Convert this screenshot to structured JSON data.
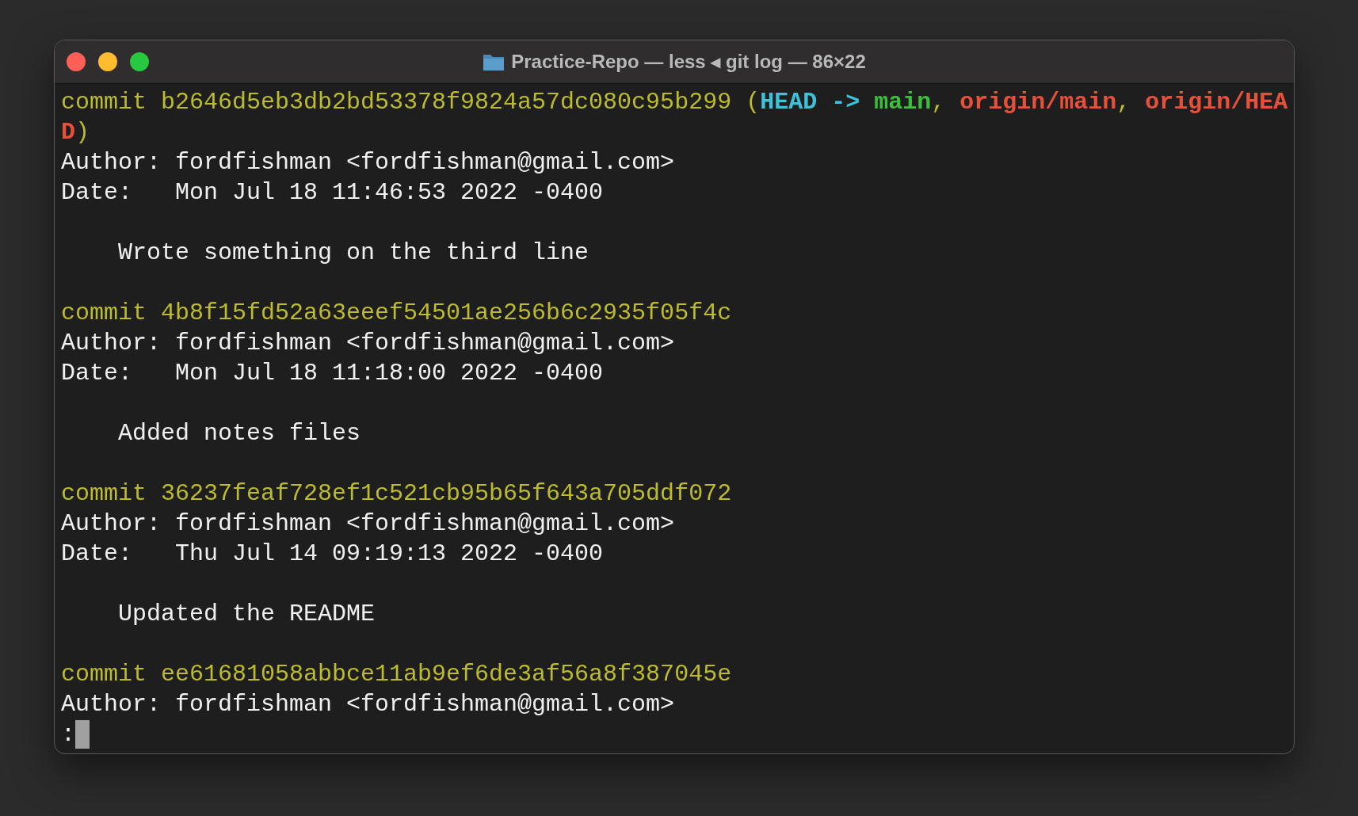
{
  "window": {
    "title": "Practice-Repo — less ◂ git log — 86×22"
  },
  "lines": [
    {
      "kind": "text",
      "segments": [
        {
          "kind": "hash",
          "text": "commit b2646d5eb3db2bd53378f9824a57dc080c95b299 ("
        },
        {
          "kind": "head",
          "text": "HEAD -> "
        },
        {
          "kind": "branch",
          "text": "main"
        },
        {
          "kind": "hash",
          "text": ", "
        },
        {
          "kind": "remote",
          "text": "origin/main"
        },
        {
          "kind": "hash",
          "text": ", "
        },
        {
          "kind": "remote",
          "text": "origin/HEA"
        }
      ]
    },
    {
      "kind": "text",
      "segments": [
        {
          "kind": "remote",
          "text": "D"
        },
        {
          "kind": "hash",
          "text": ")"
        }
      ]
    },
    {
      "kind": "text",
      "segments": [
        {
          "kind": "plain",
          "text": "Author: fordfishman <fordfishman@gmail.com>"
        }
      ]
    },
    {
      "kind": "text",
      "segments": [
        {
          "kind": "plain",
          "text": "Date:   Mon Jul 18 11:46:53 2022 -0400"
        }
      ]
    },
    {
      "kind": "blank"
    },
    {
      "kind": "text",
      "segments": [
        {
          "kind": "plain",
          "text": "    Wrote something on the third line"
        }
      ]
    },
    {
      "kind": "blank"
    },
    {
      "kind": "text",
      "segments": [
        {
          "kind": "hash",
          "text": "commit 4b8f15fd52a63eeef54501ae256b6c2935f05f4c"
        }
      ]
    },
    {
      "kind": "text",
      "segments": [
        {
          "kind": "plain",
          "text": "Author: fordfishman <fordfishman@gmail.com>"
        }
      ]
    },
    {
      "kind": "text",
      "segments": [
        {
          "kind": "plain",
          "text": "Date:   Mon Jul 18 11:18:00 2022 -0400"
        }
      ]
    },
    {
      "kind": "blank"
    },
    {
      "kind": "text",
      "segments": [
        {
          "kind": "plain",
          "text": "    Added notes files"
        }
      ]
    },
    {
      "kind": "blank"
    },
    {
      "kind": "text",
      "segments": [
        {
          "kind": "hash",
          "text": "commit 36237feaf728ef1c521cb95b65f643a705ddf072"
        }
      ]
    },
    {
      "kind": "text",
      "segments": [
        {
          "kind": "plain",
          "text": "Author: fordfishman <fordfishman@gmail.com>"
        }
      ]
    },
    {
      "kind": "text",
      "segments": [
        {
          "kind": "plain",
          "text": "Date:   Thu Jul 14 09:19:13 2022 -0400"
        }
      ]
    },
    {
      "kind": "blank"
    },
    {
      "kind": "text",
      "segments": [
        {
          "kind": "plain",
          "text": "    Updated the README"
        }
      ]
    },
    {
      "kind": "blank"
    },
    {
      "kind": "text",
      "segments": [
        {
          "kind": "hash",
          "text": "commit ee61681058abbce11ab9ef6de3af56a8f387045e"
        }
      ]
    },
    {
      "kind": "text",
      "segments": [
        {
          "kind": "plain",
          "text": "Author: fordfishman <fordfishman@gmail.com>"
        }
      ]
    },
    {
      "kind": "prompt",
      "text": ":"
    }
  ]
}
